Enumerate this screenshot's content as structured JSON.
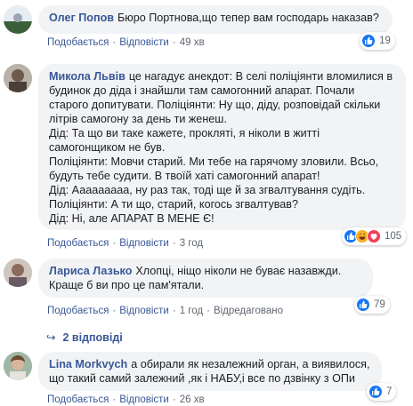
{
  "comments": [
    {
      "author": "Олег Попов",
      "text": "Бюро Портнова,що тепер вам господарь наказав?",
      "actions": {
        "like": "Подобається",
        "reply": "Відповісти",
        "time": "49 хв"
      },
      "reactions": {
        "count": "19",
        "icons": [
          "like-icon"
        ]
      }
    },
    {
      "author": "Микола Львів",
      "text": "це нагадує анекдот: В селі поліціянти вломилися в будинок до діда і знайшли там самогонний апарат. Почали старого допитувати. Поліціянти: Ну що, діду, розповідай скільки літрів самогону за день ти женеш.\nДід: Та що ви таке кажете, прокляті, я ніколи в житті самогонщиком не був.\nПоліціянти: Мовчи старий. Ми тебе на гарячому зловили. Всьо, будуть тебе судити. В твоїй хаті самогонний апарат!\nДід: Ааааааааа, ну раз так, тоді ще й за згвалтування судіть.\nПоліціянти: А ти що, старий, когось згвалтував?\nДід: Ні, але АПАРАТ В МЕНЕ Є!",
      "actions": {
        "like": "Подобається",
        "reply": "Відповісти",
        "time": "3 год"
      },
      "reactions": {
        "count": "105",
        "icons": [
          "like-icon",
          "haha-icon",
          "love-icon"
        ]
      }
    },
    {
      "author": "Лариса Лазько",
      "text": "Хлопці, ніщо ніколи не буває назавжди. Краще б ви про це пам'ятали.",
      "actions": {
        "like": "Подобається",
        "reply": "Відповісти",
        "time": "1 год",
        "edited": "Відредаговано"
      },
      "reactions": {
        "count": "79",
        "icons": [
          "like-icon"
        ]
      },
      "replies_link": "2 відповіді"
    },
    {
      "author": "Lina Morkvych",
      "text": "а обирали як незалежний орган, а виявилося, що такий самий залежний ,як і НАБУ,і все по дзвінку з ОПи",
      "actions": {
        "like": "Подобається",
        "reply": "Відповісти",
        "time": "26 хв"
      },
      "reactions": {
        "count": "7",
        "icons": [
          "like-icon"
        ]
      }
    }
  ],
  "colors": {
    "name": "#385898",
    "bubble": "#f2f3f5",
    "like": "#1877f2",
    "haha": "#f7b125",
    "love": "#f33e58"
  }
}
